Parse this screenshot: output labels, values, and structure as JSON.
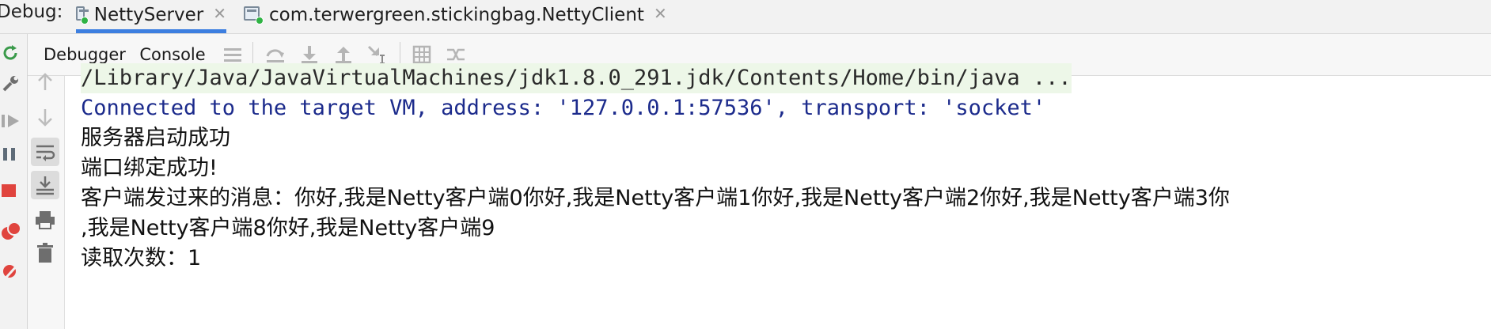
{
  "debug_bar": {
    "label": "Debug:",
    "tabs": [
      {
        "label": "NettyServer",
        "active": true
      },
      {
        "label": "com.terwergreen.stickingbag.NettyClient",
        "active": false
      }
    ]
  },
  "inner_tabs": [
    {
      "label": "Debugger",
      "active": false
    },
    {
      "label": "Console",
      "active": true
    }
  ],
  "header_icons": [
    "menu-icon",
    "step-over-icon",
    "step-into-icon",
    "step-out-icon",
    "run-to-cursor-icon",
    "evaluate-icon",
    "trace-icon"
  ],
  "outer_toolbar_icons": [
    "rerun-icon",
    "settings-wrench-icon",
    "resume-icon",
    "pause-icon",
    "stop-icon",
    "breakpoints-icon",
    "mute-breakpoints-icon"
  ],
  "gutter_icons": [
    "scroll-up-icon",
    "scroll-down-icon",
    "soft-wrap-icon",
    "scroll-to-end-icon",
    "print-icon",
    "clear-icon"
  ],
  "console": {
    "lines": [
      {
        "text": "/Library/Java/JavaVirtualMachines/jdk1.8.0_291.jdk/Contents/Home/bin/java ...",
        "kind": "command"
      },
      {
        "text": "Connected to the target VM, address: '127.0.0.1:57536', transport: 'socket'",
        "kind": "info"
      },
      {
        "text": "服务器启动成功",
        "kind": "output"
      },
      {
        "text": "端口绑定成功!",
        "kind": "output"
      },
      {
        "text": "客户端发过来的消息：你好,我是Netty客户端0你好,我是Netty客户端1你好,我是Netty客户端2你好,我是Netty客户端3你",
        "kind": "output"
      },
      {
        "text": " ,我是Netty客户端8你好,我是Netty客户端9",
        "kind": "output"
      },
      {
        "text": "读取次数：1",
        "kind": "output"
      }
    ]
  },
  "colors": {
    "accent": "#3d7fe0",
    "info_text": "#1c2b8c",
    "command_bg": "#edf7e8",
    "run_indicator": "#2fb344",
    "stop": "#e0443e"
  }
}
